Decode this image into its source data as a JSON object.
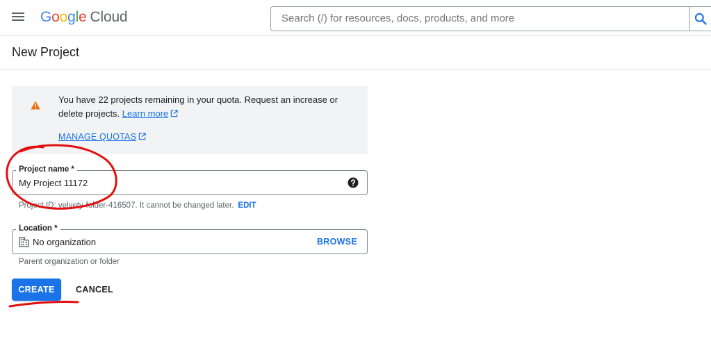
{
  "header": {
    "menu_icon": "hamburger-menu-icon",
    "logo": {
      "google": "Google",
      "cloud": "Cloud"
    },
    "search": {
      "placeholder": "Search (/) for resources, docs, products, and more",
      "icon": "search-icon"
    }
  },
  "page": {
    "title": "New Project"
  },
  "quota_banner": {
    "icon": "warning-icon",
    "text": "You have 22 projects remaining in your quota. Request an increase or delete projects.",
    "learn_more": "Learn more",
    "manage_quotas": "MANAGE QUOTAS"
  },
  "project_name": {
    "label": "Project name *",
    "value": "My Project 11172",
    "help_icon": "help-icon",
    "id_hint": "Project ID: velvety-folder-416507. It cannot be changed later.",
    "edit": "EDIT"
  },
  "location": {
    "label": "Location *",
    "icon": "building-icon",
    "value": "No organization",
    "browse": "BROWSE",
    "hint": "Parent organization or folder"
  },
  "actions": {
    "create": "CREATE",
    "cancel": "CANCEL"
  },
  "colors": {
    "accent": "#1a73e8",
    "annotation": "#e0100f",
    "warning": "#e8710a"
  }
}
